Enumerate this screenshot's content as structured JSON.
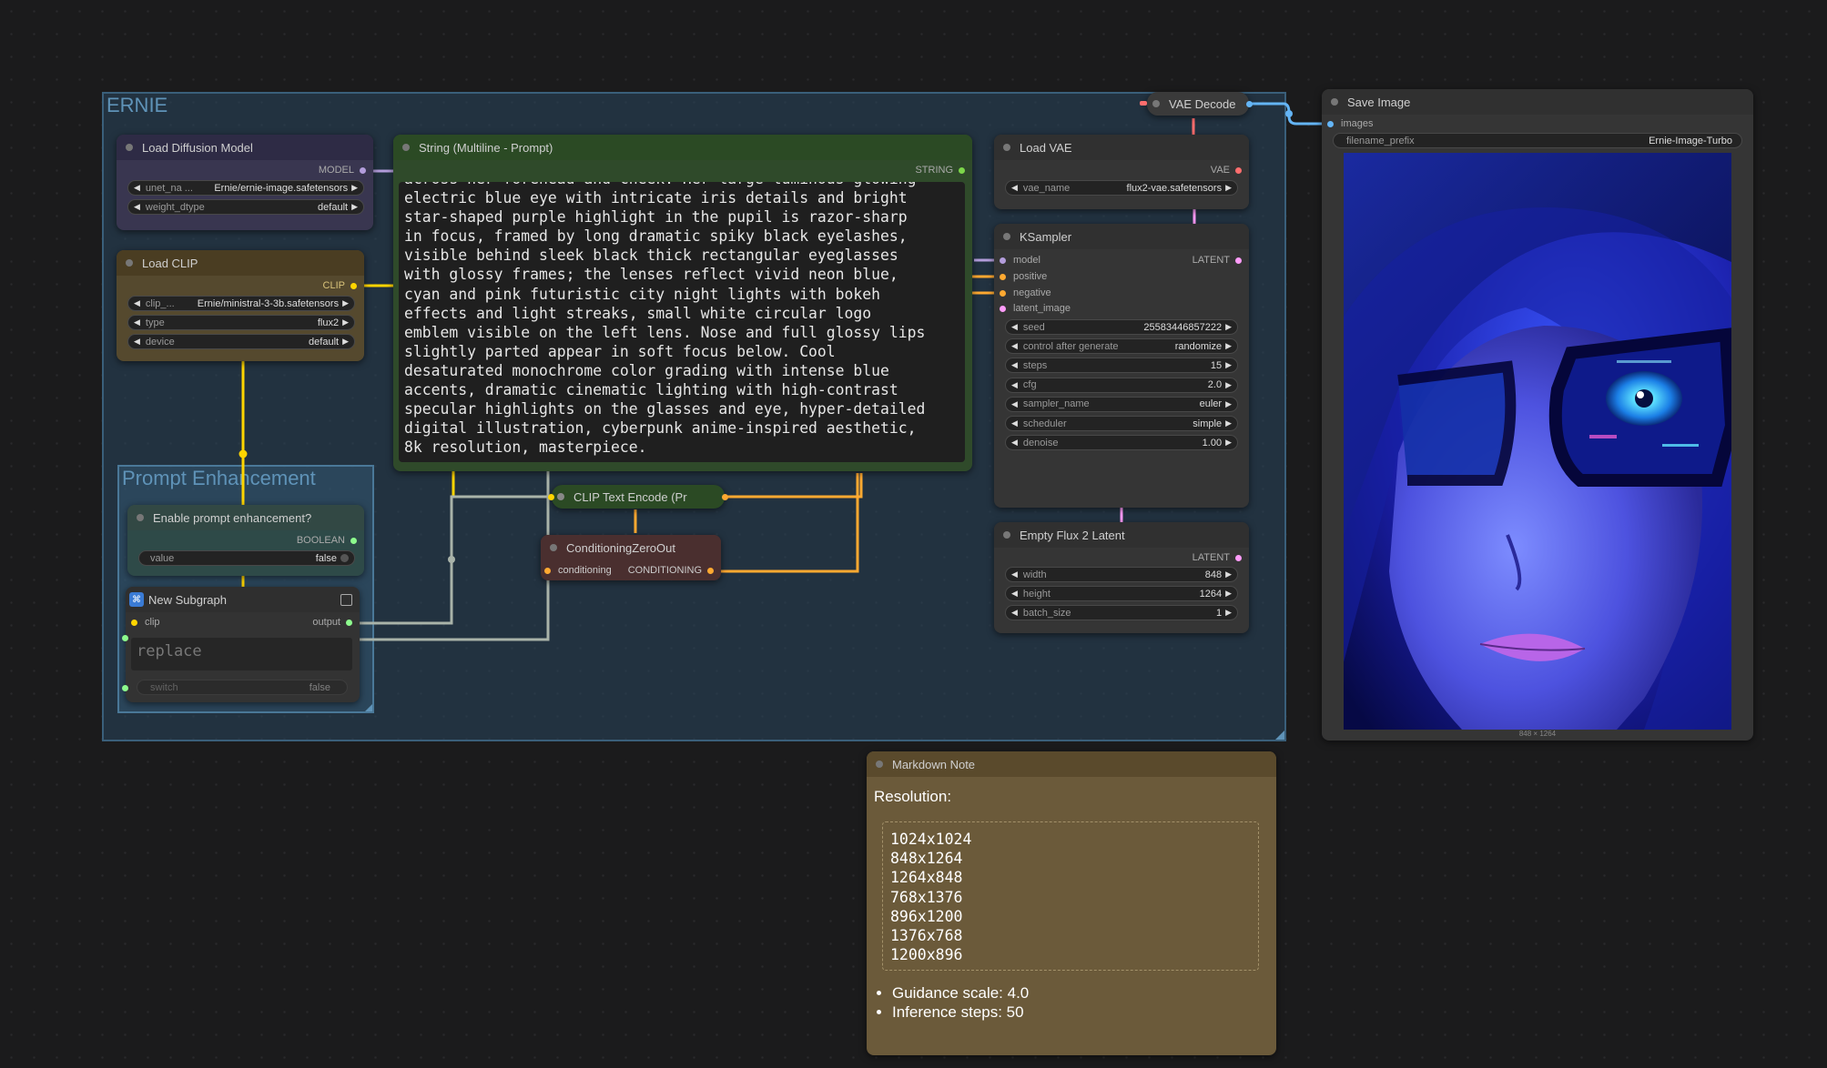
{
  "colors": {
    "model": "#b39ddb",
    "clip": "#ffd500",
    "conditioning": "#ffa931",
    "latent": "#ff9cf9",
    "vae": "#ff6e6e",
    "image": "#64b5f6",
    "string": "#7cd64a",
    "boolean": "#8dfb8d"
  },
  "groups": {
    "ernie": "ERNIE",
    "prompt_enhancement": "Prompt Enhancement"
  },
  "load_diffusion": {
    "title": "Load Diffusion Model",
    "output": "MODEL",
    "unet_label": "unet_na ...",
    "unet_value": "Ernie/ernie-image.safetensors",
    "dtype_label": "weight_dtype",
    "dtype_value": "default"
  },
  "load_clip": {
    "title": "Load CLIP",
    "output": "CLIP",
    "clip_label": "clip_...",
    "clip_value": "Ernie/ministral-3-3b.safetensors",
    "type_label": "type",
    "type_value": "flux2",
    "device_label": "device",
    "device_value": "default"
  },
  "string_prompt": {
    "title": "String (Multiline - Prompt)",
    "output": "STRING",
    "text": "across her forehead and cheek. Her large luminous glowing\nelectric blue eye with intricate iris details and bright\nstar-shaped purple highlight in the pupil is razor-sharp\nin focus, framed by long dramatic spiky black eyelashes,\nvisible behind sleek black thick rectangular eyeglasses\nwith glossy frames; the lenses reflect vivid neon blue,\ncyan and pink futuristic city night lights with bokeh\neffects and light streaks, small white circular logo\nemblem visible on the left lens. Nose and full glossy lips\nslightly parted appear in soft focus below. Cool\ndesaturated monochrome color grading with intense blue\naccents, dramatic cinematic lighting with high-contrast\nspecular highlights on the glasses and eye, hyper-detailed\ndigital illustration, cyberpunk anime-inspired aesthetic,\n8k resolution, masterpiece."
  },
  "enable_prompt": {
    "title": "Enable prompt enhancement?",
    "output": "BOOLEAN",
    "value_label": "value",
    "value": "false"
  },
  "subgraph": {
    "title": "New Subgraph",
    "input_clip": "clip",
    "output": "output",
    "placeholder": "replace",
    "switch_label": "switch",
    "switch_value": "false"
  },
  "clip_text_encode": {
    "title": "CLIP Text Encode (Pr"
  },
  "cond_zero": {
    "title": "ConditioningZeroOut",
    "input": "conditioning",
    "output": "CONDITIONING"
  },
  "vae_decode": {
    "title": "VAE Decode"
  },
  "load_vae": {
    "title": "Load VAE",
    "output": "VAE",
    "vae_label": "vae_name",
    "vae_value": "flux2-vae.safetensors"
  },
  "ksampler": {
    "title": "KSampler",
    "inputs": [
      "model",
      "positive",
      "negative",
      "latent_image"
    ],
    "output": "LATENT",
    "widgets": [
      [
        "seed",
        "25583446857222"
      ],
      [
        "control after generate",
        "randomize"
      ],
      [
        "steps",
        "15"
      ],
      [
        "cfg",
        "2.0"
      ],
      [
        "sampler_name",
        "euler"
      ],
      [
        "scheduler",
        "simple"
      ],
      [
        "denoise",
        "1.00"
      ]
    ]
  },
  "empty_latent": {
    "title": "Empty Flux 2 Latent",
    "output": "LATENT",
    "widgets": [
      [
        "width",
        "848"
      ],
      [
        "height",
        "1264"
      ],
      [
        "batch_size",
        "1"
      ]
    ]
  },
  "save_image": {
    "title": "Save Image",
    "input": "images",
    "prefix_label": "filename_prefix",
    "prefix_value": "Ernie-Image-Turbo",
    "size_caption": "848 × 1264"
  },
  "markdown": {
    "title": "Markdown Note",
    "heading": "Resolution:",
    "resolutions": [
      "1024x1024",
      "848x1264",
      "1264x848",
      "768x1376",
      "896x1200",
      "1376x768",
      "1200x896"
    ],
    "bullets": [
      "Guidance scale: 4.0",
      "Inference steps: 50"
    ]
  }
}
